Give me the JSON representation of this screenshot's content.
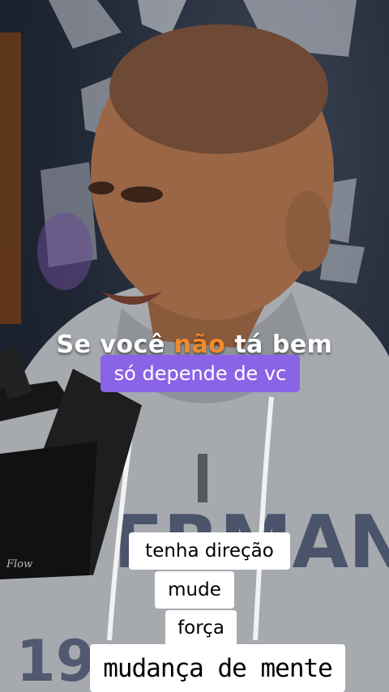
{
  "captions": {
    "main_prefix": "Se você ",
    "main_highlight": "não",
    "main_suffix": " tá bem",
    "purple_line": "só depende de vc",
    "line_1": "tenha direção",
    "line_2": "mude",
    "line_3": "força",
    "line_4": "mudança de mente"
  },
  "colors": {
    "highlight": "#f28b2a",
    "purple_pill": "#8b63e6",
    "white_pill": "#ffffff"
  },
  "microphone": {
    "brand": "Flow"
  }
}
